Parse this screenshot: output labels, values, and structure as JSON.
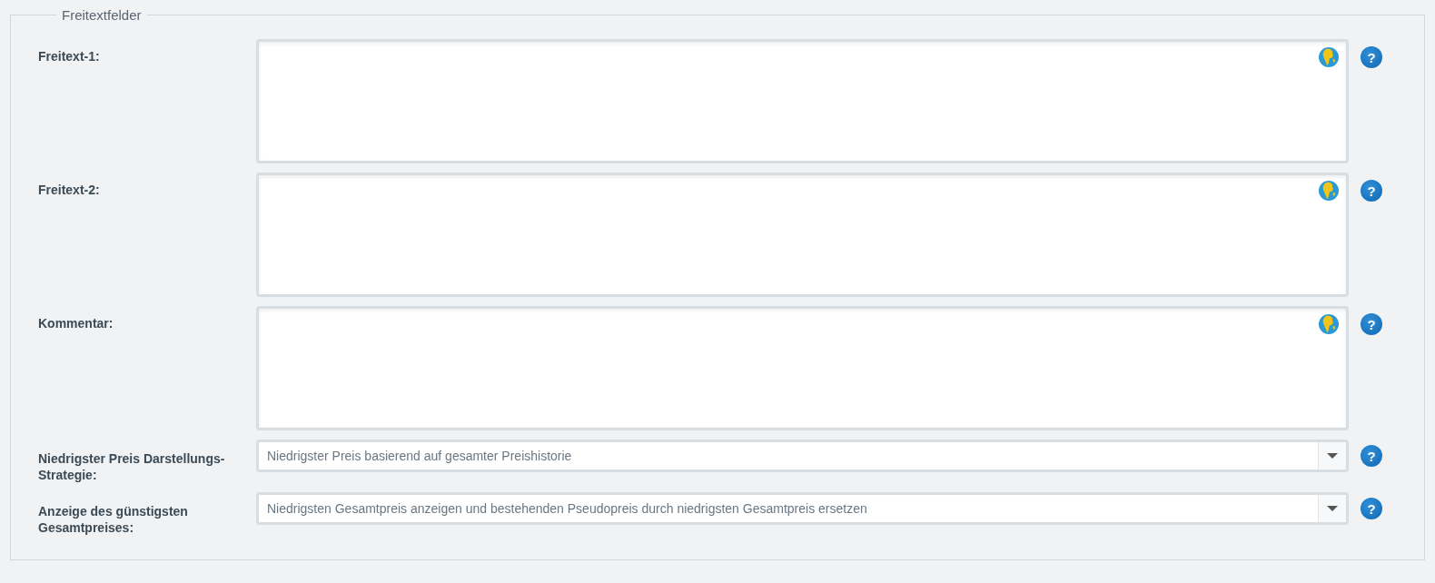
{
  "legend": "Freitextfelder",
  "fields": [
    {
      "kind": "textarea",
      "label": "Freitext-1:",
      "help": "?"
    },
    {
      "kind": "textarea",
      "label": "Freitext-2:",
      "help": "?"
    },
    {
      "kind": "textarea",
      "label": "Kommentar:",
      "help": "?"
    },
    {
      "kind": "select",
      "label": "Niedrigster Preis Darstellungs-Strategie:",
      "value": "Niedrigster Preis basierend auf gesamter Preishistorie",
      "help": "?"
    },
    {
      "kind": "select",
      "label": "Anzeige des günstigsten Gesamtpreises:",
      "value": "Niedrigsten Gesamtpreis anzeigen und bestehenden Pseudopreis durch niedrigsten Gesamtpreis ersetzen",
      "help": "?"
    }
  ]
}
